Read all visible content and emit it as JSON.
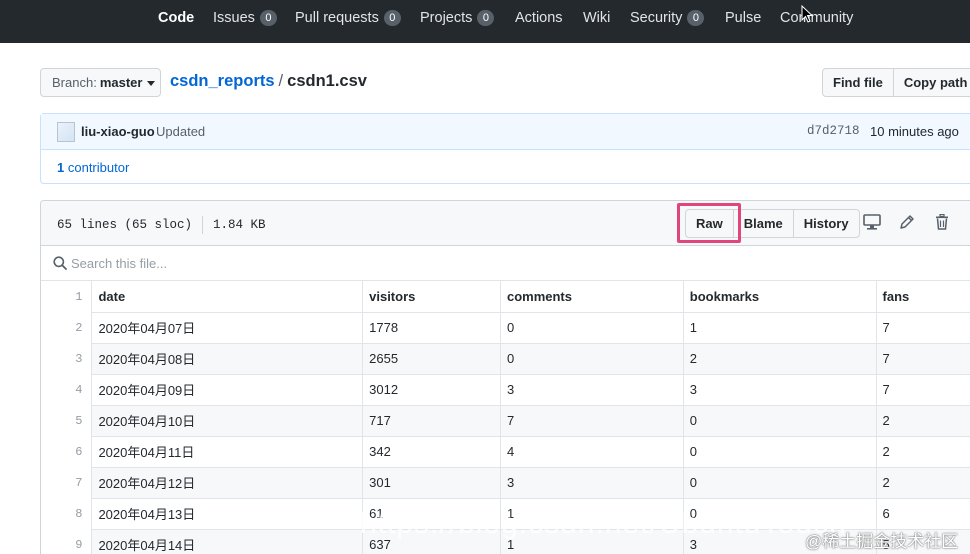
{
  "nav": {
    "tabs": [
      {
        "label": "Code",
        "count": null,
        "active": true
      },
      {
        "label": "Issues",
        "count": "0"
      },
      {
        "label": "Pull requests",
        "count": "0"
      },
      {
        "label": "Projects",
        "count": "0"
      },
      {
        "label": "Actions",
        "count": null
      },
      {
        "label": "Wiki",
        "count": null
      },
      {
        "label": "Security",
        "count": "0"
      },
      {
        "label": "Pulse",
        "count": null
      },
      {
        "label": "Community",
        "count": null
      }
    ]
  },
  "branch": {
    "prefix": "Branch:",
    "name": "master"
  },
  "breadcrumb": {
    "repo": "csdn_reports",
    "separator": "/",
    "file": "csdn1.csv"
  },
  "file_actions": {
    "find_file": "Find file",
    "copy_path": "Copy path"
  },
  "commit": {
    "author": "liu-xiao-guo",
    "action": "Updated",
    "sha": "d7d2718",
    "time": "10 minutes ago",
    "contributors_count": "1",
    "contributors_label": "contributor"
  },
  "file": {
    "lines": "65 lines (65 sloc)",
    "size": "1.84 KB",
    "buttons": {
      "raw": "Raw",
      "blame": "Blame",
      "history": "History"
    },
    "search_placeholder": "Search this file..."
  },
  "table": {
    "headers": [
      "date",
      "visitors",
      "comments",
      "bookmarks",
      "fans"
    ],
    "rows": [
      [
        "2020年04月07日",
        "1778",
        "0",
        "1",
        "7"
      ],
      [
        "2020年04月08日",
        "2655",
        "0",
        "2",
        "7"
      ],
      [
        "2020年04月09日",
        "3012",
        "3",
        "3",
        "7"
      ],
      [
        "2020年04月10日",
        "717",
        "7",
        "0",
        "2"
      ],
      [
        "2020年04月11日",
        "342",
        "4",
        "0",
        "2"
      ],
      [
        "2020年04月12日",
        "301",
        "3",
        "0",
        "2"
      ],
      [
        "2020年04月13日",
        "61",
        "1",
        "0",
        "6"
      ],
      [
        "2020年04月14日",
        "637",
        "1",
        "3",
        "5"
      ]
    ]
  },
  "watermark": {
    "text": "https://blog.csdn.net/UbuntuTouch",
    "badge": "@稀土掘金技术社区"
  }
}
